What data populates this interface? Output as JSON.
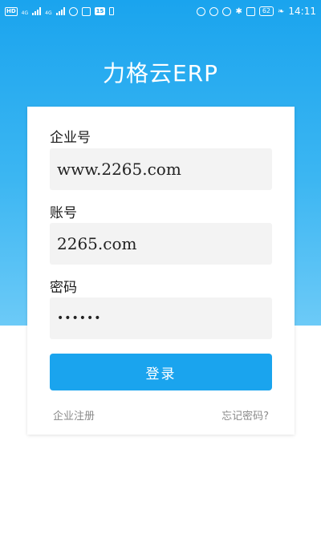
{
  "status_bar": {
    "hd_tag": "HD",
    "net_1": "4G",
    "net_2": "4G",
    "notif_badge": "15",
    "battery_level": "62",
    "time": "14:11"
  },
  "app_title": "力格云ERP",
  "form": {
    "company_label": "企业号",
    "company_value": "www.2265.com",
    "account_label": "账号",
    "account_value": "2265.com",
    "password_label": "密码",
    "password_value": "••••••",
    "login_label": "登录"
  },
  "links": {
    "register": "企业注册",
    "forgot": "忘记密码?"
  },
  "colors": {
    "accent": "#1aa4ee",
    "field_bg": "#f3f3f3",
    "link_text": "#8a8a8a"
  }
}
